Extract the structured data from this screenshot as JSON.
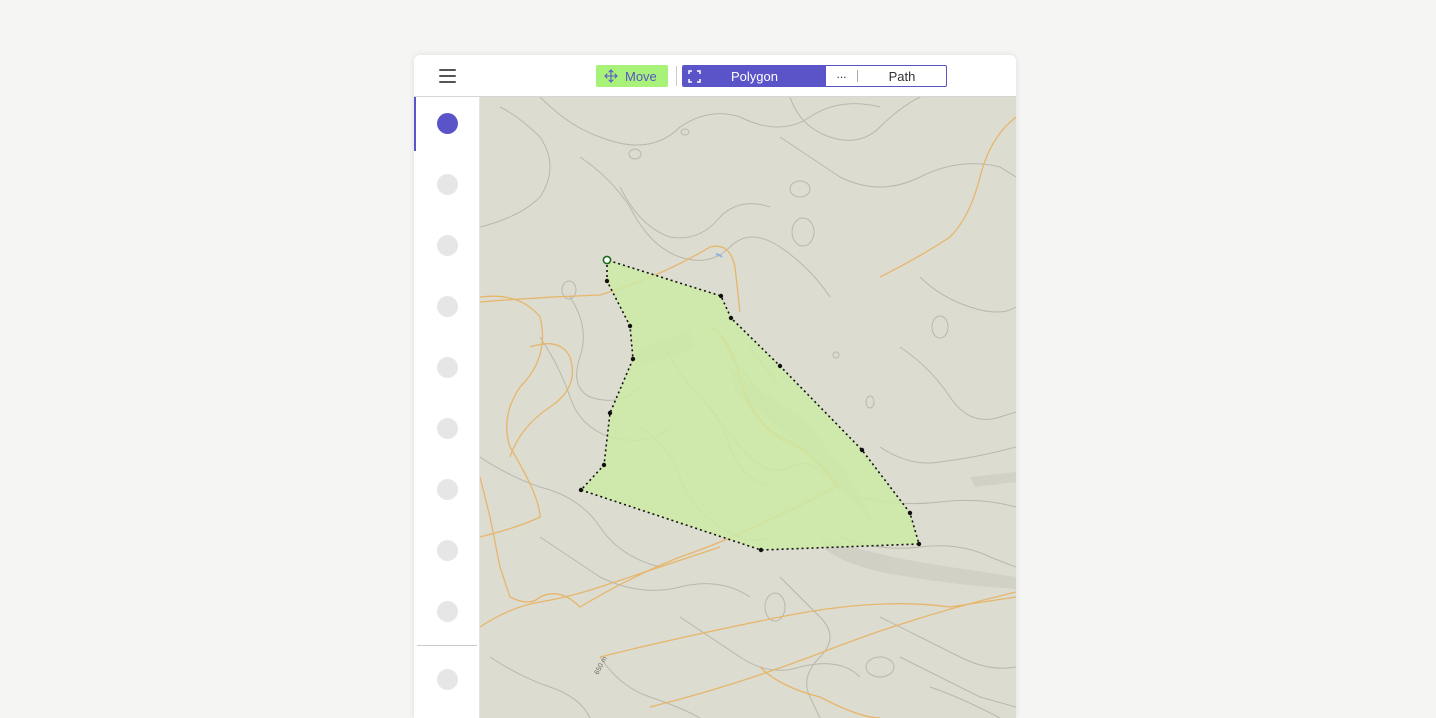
{
  "toolbar": {
    "menu_icon": "hamburger-menu-icon",
    "move_label": "Move",
    "move_icon": "move-arrows-icon",
    "polygon_label": "Polygon",
    "polygon_icon": "fullscreen-corners-icon",
    "more_label": "...",
    "path_label": "Path"
  },
  "sidebar": {
    "items": [
      {
        "active": true
      },
      {
        "active": false
      },
      {
        "active": false
      },
      {
        "active": false
      },
      {
        "active": false
      },
      {
        "active": false
      },
      {
        "active": false
      },
      {
        "active": false
      },
      {
        "active": false
      }
    ],
    "footer_items": [
      {
        "active": false
      }
    ]
  },
  "map": {
    "elevation_label": "650 m"
  },
  "colors": {
    "accent": "#5a54c8",
    "move_button": "#a8f27a",
    "polygon_fill": "#cdeaa4",
    "map_background": "#dddcd1",
    "road": "#e6b66b",
    "contour": "#b9b8ac"
  }
}
